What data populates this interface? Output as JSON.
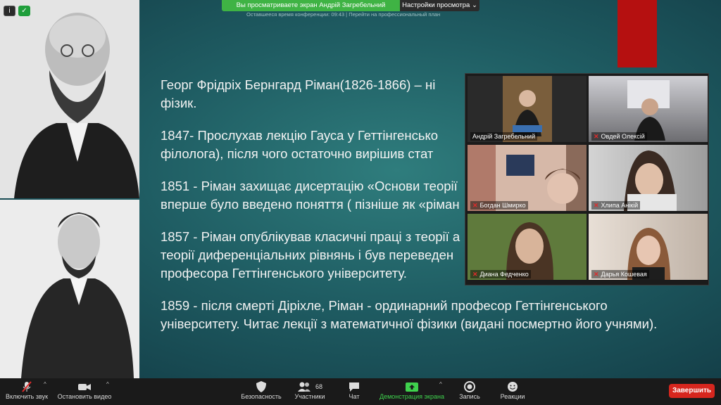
{
  "banner": {
    "viewing_text": "Вы просматриваете экран Андрій Загребельний",
    "view_settings": "Настройки просмотра",
    "sub_text": "Оставшееся время конференции: 09:43 | Перейти на профессиональный план"
  },
  "slide": {
    "paragraphs": [
      "Георг Фрідріх Бернгард Ріман(1826-1866) – ні",
      "фізик.",
      "1847- Прослухав лекцію Гауса у Геттінгенсько",
      "філолога), після чого остаточно вирішив стат",
      "1851 - Ріман захищає дисертацію «Основи теорії",
      "вперше було введено поняття ( пізніше як «ріман",
      "1857 - Ріман опублікував класичні праці з теорії а",
      "теорії диференціальних рівнянь і був переведен",
      "професора Геттінгенського університету.",
      "1859 - після смерті Діріхле, Ріман - ординарний професор Геттінгенського",
      "університету. Читає лекції з математичної фізики (видані посмертно його учнями)."
    ]
  },
  "participants": [
    {
      "name": "Андрій Загребельний",
      "muted": false
    },
    {
      "name": "Овдей Олексій",
      "muted": true
    },
    {
      "name": "Богдан Шмирко",
      "muted": true
    },
    {
      "name": "Хлипа Анікій",
      "muted": true
    },
    {
      "name": "Диана Федченко",
      "muted": true
    },
    {
      "name": "Дарья Кошевая",
      "muted": true
    }
  ],
  "toolbar": {
    "mute_label": "Включить звук",
    "video_label": "Остановить видео",
    "security_label": "Безопасность",
    "participants_label": "Участники",
    "participants_count": "68",
    "chat_label": "Чат",
    "share_label": "Демонстрация экрана",
    "record_label": "Запись",
    "reactions_label": "Реакции",
    "end_label": "Завершить"
  },
  "colors": {
    "accent_green": "#3fb344",
    "end_red": "#d7261e",
    "slide_teal": "#1f5d63"
  }
}
